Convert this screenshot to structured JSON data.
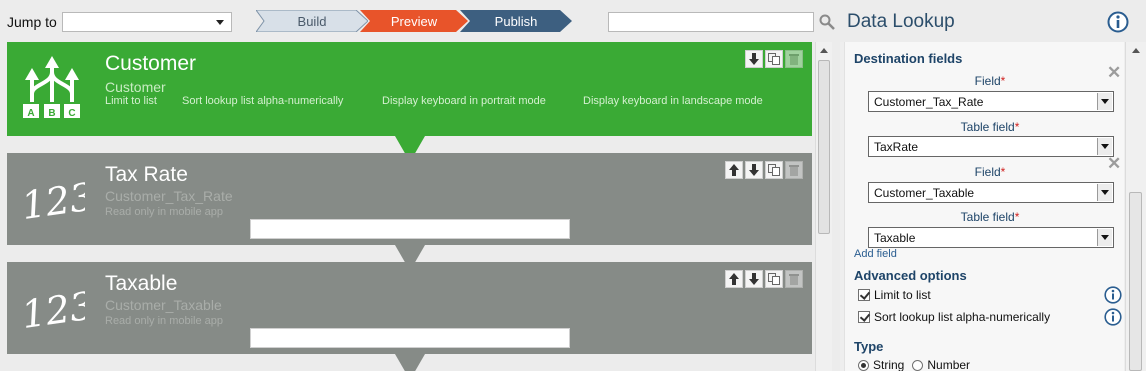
{
  "topbar": {
    "jump_label": "Jump to",
    "jump_value": "",
    "search_value": ""
  },
  "steps": [
    {
      "label": "Build",
      "color": "#d8e0e8"
    },
    {
      "label": "Preview",
      "color": "#e8542a"
    },
    {
      "label": "Publish",
      "color": "#3d5f80"
    }
  ],
  "cards": {
    "customer": {
      "title": "Customer",
      "subtitle": "Customer",
      "options": [
        "Limit to list",
        "Sort lookup list alpha-numerically",
        "Display keyboard in portrait mode",
        "Display keyboard in landscape mode"
      ],
      "icon_letters": [
        "A",
        "B",
        "C"
      ],
      "color": "#3aaa35"
    },
    "tax_rate": {
      "title": "Tax Rate",
      "subtitle": "Customer_Tax_Rate",
      "meta": "Read only in mobile app",
      "icon_text": "123",
      "value": ""
    },
    "taxable": {
      "title": "Taxable",
      "subtitle": "Customer_Taxable",
      "meta": "Read only in mobile app",
      "icon_text": "123",
      "value": ""
    }
  },
  "panel": {
    "title": "Data Lookup",
    "destination_title": "Destination fields",
    "mappings": [
      {
        "field_label": "Field",
        "field_value": "Customer_Tax_Rate",
        "table_label": "Table field",
        "table_value": "TaxRate"
      },
      {
        "field_label": "Field",
        "field_value": "Customer_Taxable",
        "table_label": "Table field",
        "table_value": "Taxable"
      }
    ],
    "required_mark": "*",
    "add_field": "Add field",
    "advanced_title": "Advanced options",
    "advanced": [
      {
        "label": "Limit to list",
        "checked": true
      },
      {
        "label": "Sort lookup list alpha-numerically",
        "checked": true
      }
    ],
    "type_title": "Type",
    "type_options": [
      {
        "label": "String",
        "selected": true
      },
      {
        "label": "Number",
        "selected": false
      }
    ]
  }
}
